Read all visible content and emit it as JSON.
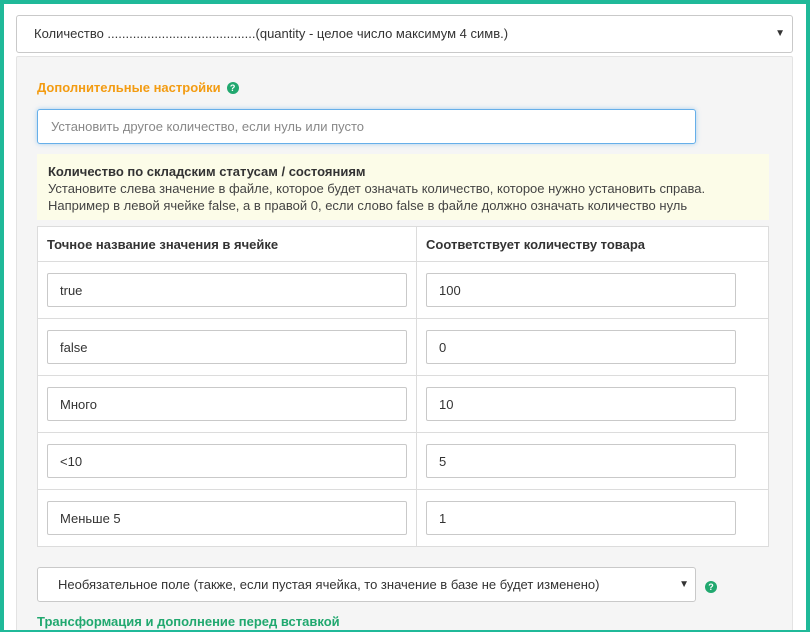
{
  "top_select": {
    "value": "Количество .........................................(quantity - целое число максимум 4 симв.)"
  },
  "panel": {
    "section_title": "Дополнительные настройки",
    "help_glyph": "?",
    "other_qty_placeholder": "Установить другое количество, если нуль или пусто",
    "notice": {
      "title": "Количество по складским статусам / состояниям",
      "text": "Установите слева значение в файле, которое будет означать количество, которое нужно установить справа. Например в левой ячейке false, а в правой 0, если слово false в файле должно означать количество нуль"
    },
    "table": {
      "headers": [
        "Точное название значения в ячейке",
        "Соответствует количеству товара"
      ],
      "rows": [
        {
          "value": "true",
          "quantity": "100"
        },
        {
          "value": "false",
          "quantity": "0"
        },
        {
          "value": "Много",
          "quantity": "10"
        },
        {
          "value": "<10",
          "quantity": "5"
        },
        {
          "value": "Меньше 5",
          "quantity": "1"
        }
      ]
    },
    "optional_select": "Необязательное поле (также, если пустая ячейка, то значение в базе не будет изменено)",
    "transform_link": "Трансформация и дополнение перед вставкой"
  },
  "colors": {
    "frame_border": "#20b999",
    "section_title": "#f39c12",
    "help_icon": "#21a86f",
    "link": "#21a86f",
    "notice_bg": "#fcfce8",
    "focus_border": "#66afe9"
  },
  "icons": {
    "caret": "caret-down-icon",
    "help": "question-circle-icon"
  }
}
